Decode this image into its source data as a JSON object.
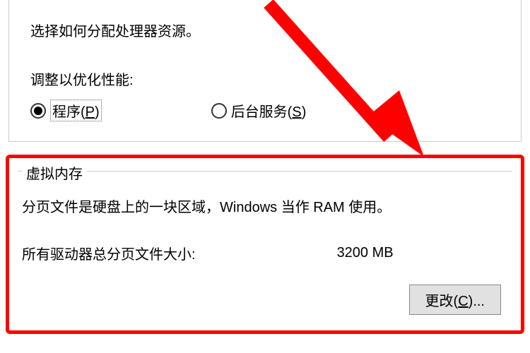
{
  "processor_scheduling": {
    "description": "选择如何分配处理器资源。",
    "adjust_label": "调整以优化性能:",
    "option_programs": "程序(P)",
    "option_background": "后台服务(S)",
    "selected": "programs"
  },
  "virtual_memory": {
    "legend": "虚拟内存",
    "description": "分页文件是硬盘上的一块区域，Windows 当作 RAM 使用。",
    "total_label": "所有驱动器总分页文件大小:",
    "total_value": "3200 MB",
    "change_button": "更改(C)..."
  },
  "annotation": {
    "arrow_color": "#ff0000"
  }
}
